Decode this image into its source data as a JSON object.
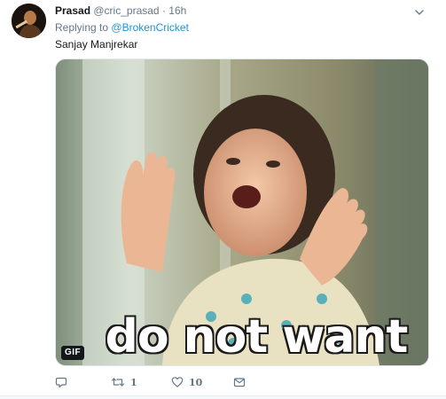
{
  "tweet": {
    "author_name": "Prasad",
    "author_handle": "@cric_prasad",
    "separator": "·",
    "time": "16h",
    "reply_prefix": "Replying to",
    "reply_to": "@BrokenCricket",
    "text": "Sanjay Manjrekar",
    "media": {
      "badge": "GIF",
      "caption": "do not want"
    },
    "actions": {
      "reply_icon": "reply-icon",
      "retweet_icon": "retweet-icon",
      "retweet_count": "1",
      "like_icon": "heart-icon",
      "like_count": "10",
      "message_icon": "envelope-icon"
    }
  },
  "colors": {
    "link": "#1b95e0",
    "muted": "#657786",
    "text": "#14171a"
  }
}
